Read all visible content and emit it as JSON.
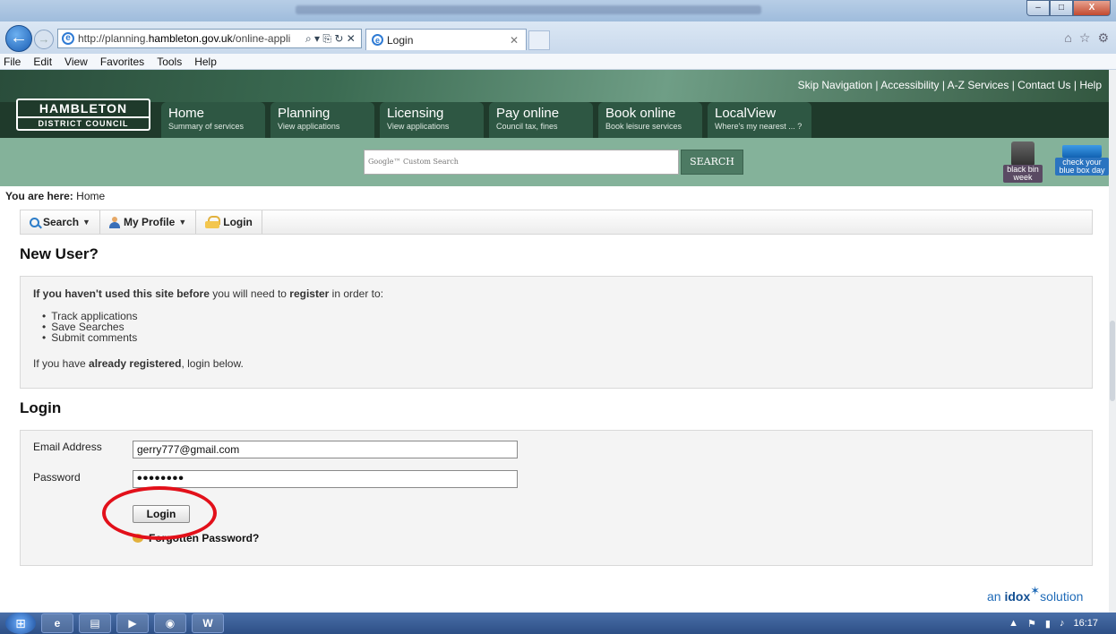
{
  "browser": {
    "address_url_prefix": "http://planning.",
    "address_url_domain": "hambleton.gov.uk",
    "address_url_suffix": "/online-appli",
    "tab_title": "Login",
    "menu": [
      "File",
      "Edit",
      "View",
      "Favorites",
      "Tools",
      "Help"
    ]
  },
  "site": {
    "skip_links": [
      "Skip Navigation",
      "Accessibility",
      "A-Z Services",
      "Contact Us",
      "Help"
    ],
    "logo_line1": "HAMBLETON",
    "logo_line2": "DISTRICT COUNCIL",
    "nav": [
      {
        "title": "Home",
        "subtitle": "Summary of services"
      },
      {
        "title": "Planning",
        "subtitle": "View applications"
      },
      {
        "title": "Licensing",
        "subtitle": "View applications"
      },
      {
        "title": "Pay online",
        "subtitle": "Council tax, fines"
      },
      {
        "title": "Book online",
        "subtitle": "Book leisure services"
      },
      {
        "title": "LocalView",
        "subtitle": "Where's my nearest ... ?"
      }
    ],
    "search_placeholder": "Google™ Custom Search",
    "search_button": "SEARCH",
    "bin_widget_line1": "black bin",
    "bin_widget_line2": "week",
    "box_widget_line1": "check your",
    "box_widget_line2": "blue box day"
  },
  "page": {
    "breadcrumb_label": "You are here:",
    "breadcrumb_value": "Home",
    "toolbar": {
      "search": "Search",
      "profile": "My Profile",
      "login": "Login"
    },
    "new_user_heading": "New User?",
    "intro_bold": "If you haven't used this site before",
    "intro_mid": " you will need to ",
    "intro_register": "register",
    "intro_end": " in order to:",
    "bullets": [
      "Track applications",
      "Save Searches",
      "Submit comments"
    ],
    "already_pre": "If you have ",
    "already_bold": "already registered",
    "already_post": ", login below.",
    "login_heading": "Login",
    "email_label": "Email Address",
    "email_value": "gerry777@gmail.com",
    "password_label": "Password",
    "password_value": "••••••••",
    "login_button": "Login",
    "forgot_password": "Forgotten Password?",
    "powered_pre": "an ",
    "powered_brand": "idox",
    "powered_post": "solution"
  },
  "taskbar": {
    "time": "16:17",
    "apps": [
      "e",
      "▤",
      "▶",
      "◉",
      "W"
    ]
  },
  "annotation_color": "#e2101a"
}
